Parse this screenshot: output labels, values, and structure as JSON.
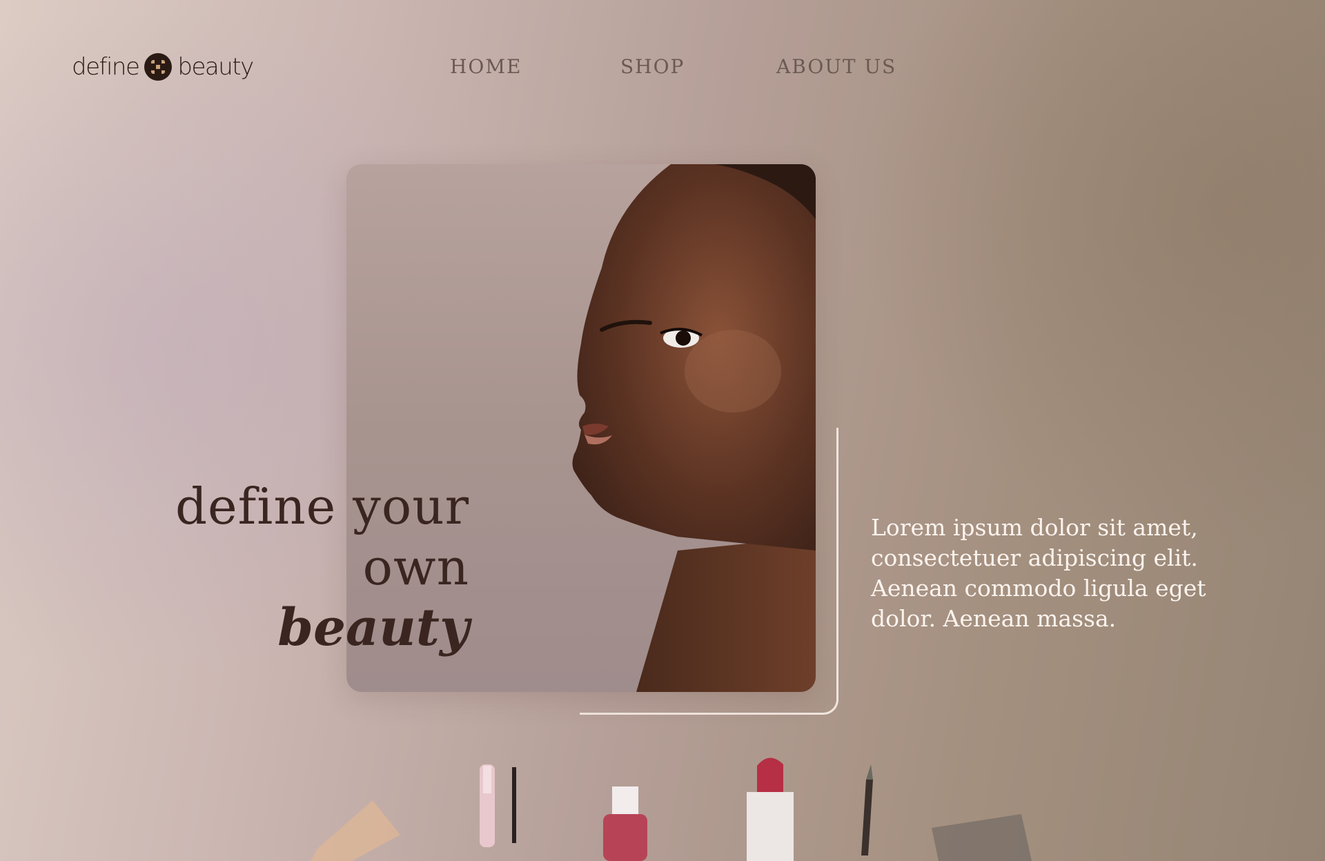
{
  "brand": {
    "logo_left": "define",
    "logo_right": "beauty"
  },
  "nav": {
    "items": [
      "HOME",
      "SHOP",
      "ABOUT US"
    ]
  },
  "hero": {
    "headline_line1": "define your own",
    "headline_line2": "beauty",
    "description": "Lorem ipsum dolor sit amet, consectetuer adipiscing elit. Aenean commodo ligula eget dolor. Aenean massa."
  },
  "colors": {
    "text_dark": "#3a2520",
    "nav_text": "#6a5a52",
    "accent_line": "#f1e6e0",
    "description_text": "#fbf3ee"
  }
}
